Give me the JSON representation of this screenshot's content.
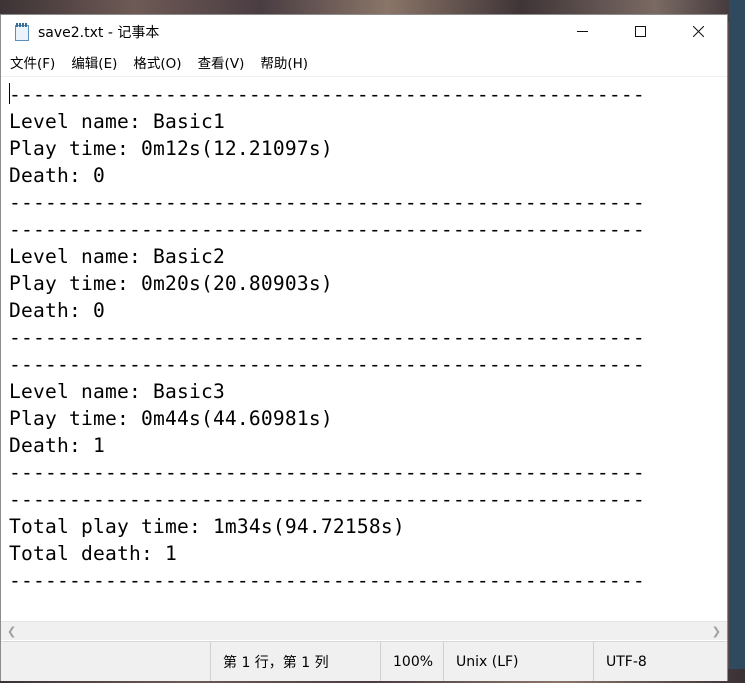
{
  "window": {
    "title": "save2.txt - 记事本",
    "controls": {
      "minimize_icon": "minimize-icon",
      "maximize_icon": "maximize-icon",
      "close_icon": "close-icon"
    }
  },
  "menu": [
    "文件(F)",
    "编辑(E)",
    "格式(O)",
    "查看(V)",
    "帮助(H)"
  ],
  "content": {
    "lines": [
      "-----------------------------------------------------",
      "Level name: Basic1",
      "Play time: 0m12s(12.21097s)",
      "Death: 0",
      "-----------------------------------------------------",
      "-----------------------------------------------------",
      "Level name: Basic2",
      "Play time: 0m20s(20.80903s)",
      "Death: 0",
      "-----------------------------------------------------",
      "-----------------------------------------------------",
      "Level name: Basic3",
      "Play time: 0m44s(44.60981s)",
      "Death: 1",
      "-----------------------------------------------------",
      "-----------------------------------------------------",
      "Total play time: 1m34s(94.72158s)",
      "Total death: 1",
      "-----------------------------------------------------"
    ]
  },
  "status": {
    "position": "第 1 行，第 1 列",
    "zoom": "100%",
    "line_ending": "Unix (LF)",
    "encoding": "UTF-8"
  }
}
